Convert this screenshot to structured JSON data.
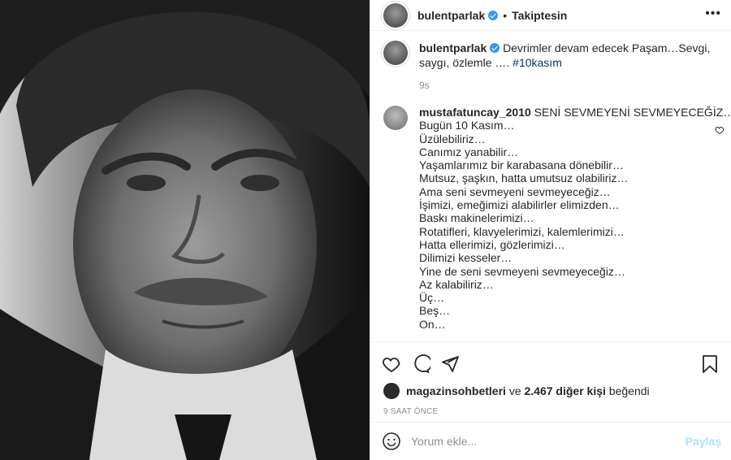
{
  "header": {
    "username": "bulentparlak",
    "separator": "•",
    "follow_status": "Takiptesin",
    "more_label": "•••"
  },
  "caption": {
    "username": "bulentparlak",
    "text": "Devrimler devam edecek Paşam…Sevgi, saygı, özlemle ….",
    "hashtag": "#10kasım",
    "time": "9s"
  },
  "comment": {
    "username": "mustafatuncay_2010",
    "lines": [
      "SENİ SEVMEYENİ SEVMEYECEĞİZ…",
      "Bugün 10 Kasım…",
      "Üzülebiliriz…",
      "Canımız yanabilir…",
      "Yaşamlarımız bir karabasana dönebilir…",
      "Mutsuz, şaşkın, hatta umutsuz olabiliriz…",
      "Ama seni sevmeyeni sevmeyeceğiz…",
      "İşimizi, emeğimizi alabilirler elimizden…",
      "Baskı makinelerimizi…",
      "Rotatifleri, klavyelerimizi, kalemlerimizi…",
      "Hatta ellerimizi, gözlerimizi…",
      "Dilimizi kesseler…",
      "Yine de seni sevmeyeni sevmeyeceğiz…",
      "Az kalabiliriz…",
      "Üç…",
      "Beş…",
      "On…"
    ]
  },
  "likes": {
    "first_user": "magazinsohbetleri",
    "connector": "ve",
    "others": "2.467 diğer kişi",
    "suffix": "beğendi"
  },
  "posted_ago": "9 SAAT ÖNCE",
  "add_comment": {
    "placeholder": "Yorum ekle...",
    "share_label": "Paylaş"
  },
  "icons": {
    "like": "heart-icon",
    "comment": "comment-icon",
    "share": "paper-plane-icon",
    "save": "bookmark-icon",
    "emoji": "smiley-icon",
    "verified": "verified-badge-icon"
  }
}
